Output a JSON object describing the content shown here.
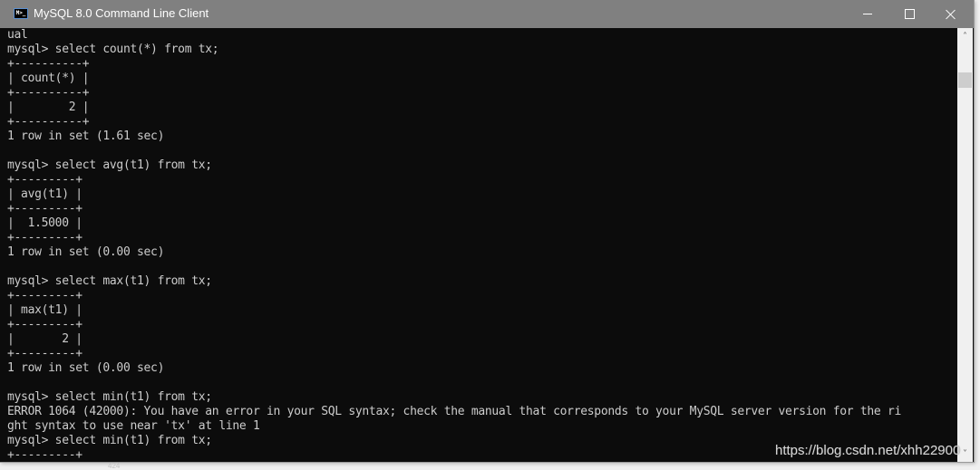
{
  "window": {
    "title": "MySQL 8.0 Command Line Client",
    "app_icon": "console-icon",
    "icon_text": "M>_",
    "controls": {
      "minimize": "minimize-icon",
      "maximize": "maximize-icon",
      "close": "close-icon"
    }
  },
  "console": {
    "lines": [
      "ual",
      "mysql> select count(*) from tx;",
      "+----------+",
      "| count(*) |",
      "+----------+",
      "|        2 |",
      "+----------+",
      "1 row in set (1.61 sec)",
      "",
      "mysql> select avg(t1) from tx;",
      "+---------+",
      "| avg(t1) |",
      "+---------+",
      "|  1.5000 |",
      "+---------+",
      "1 row in set (0.00 sec)",
      "",
      "mysql> select max(t1) from tx;",
      "+---------+",
      "| max(t1) |",
      "+---------+",
      "|       2 |",
      "+---------+",
      "1 row in set (0.00 sec)",
      "",
      "mysql> select min(t1) from tx;",
      "ERROR 1064 (42000): You have an error in your SQL syntax; check the manual that corresponds to your MySQL server version for the ri",
      "ght syntax to use near 'tx' at line 1",
      "mysql> select min(t1) from tx;",
      "+---------+"
    ]
  },
  "scrollbar": {
    "up_glyph": "˄",
    "down_glyph": "˅"
  },
  "watermark": "https://blog.csdn.net/xhh22900",
  "below_window_text": "424"
}
